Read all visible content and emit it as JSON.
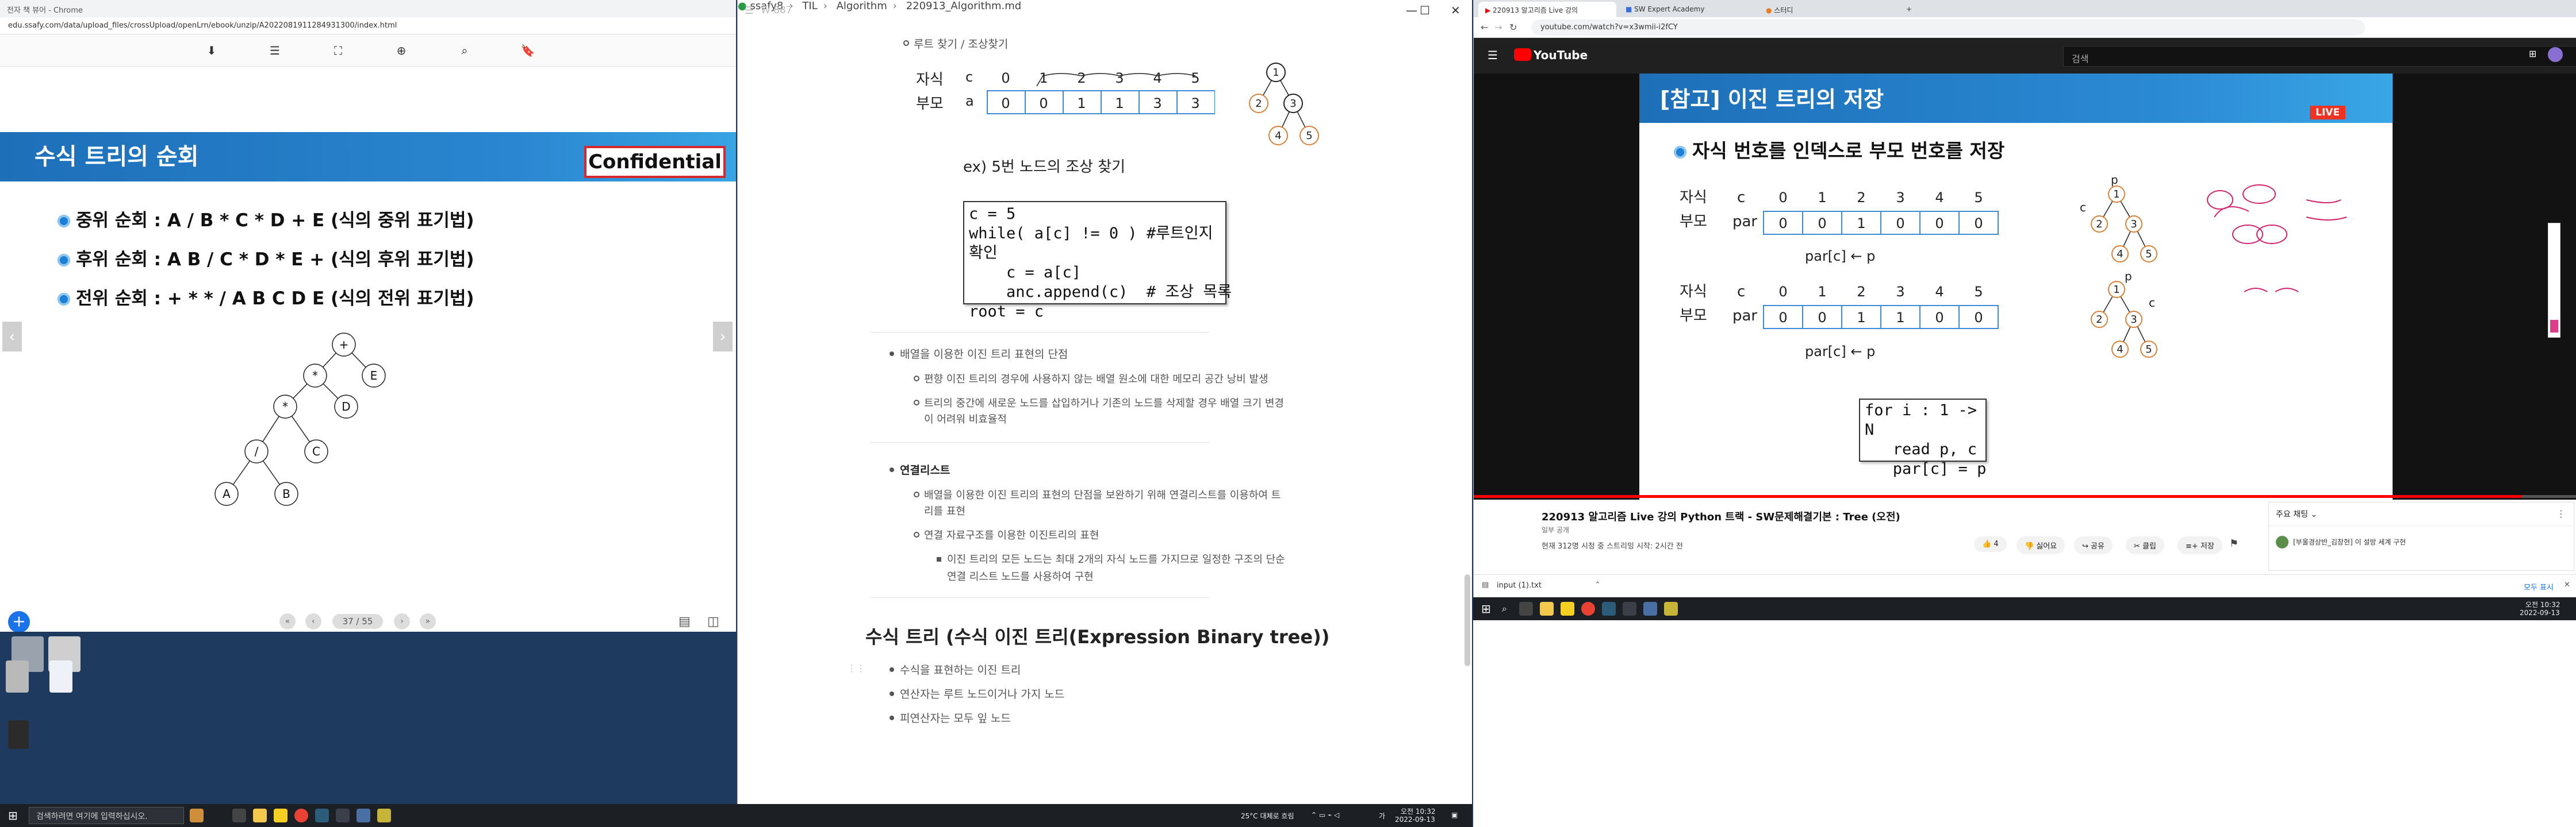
{
  "ebook": {
    "window_title": "전자 책 뷰어 - Chrome",
    "url": "edu.ssafy.com/data/upload_files/crossUpload/openLrn/ebook/unzip/A2022081911284931300/index.html",
    "slide_title": "수식 트리의 순회",
    "confidential": "Confidential",
    "bullets": [
      "중위 순회 : A / B * C * D + E  (식의 중위 표기법)",
      "후위 순회 : A B / C * D * E + (식의 후위 표기법)",
      "전위 순회 : + * * / A B C D E (식의 전위 표기법)"
    ],
    "tree_nodes": [
      "+",
      "*",
      "E",
      "*",
      "D",
      "/",
      "C",
      "A",
      "B"
    ],
    "page_count": "37 / 55"
  },
  "typora": {
    "faded_title": "W 887",
    "breadcrumb": [
      "ssafy8",
      "TIL",
      "Algorithm",
      "220913_Algorithm.md"
    ],
    "root_find": "루트 찾기 / 조상찾기",
    "row_child": "자식",
    "row_parent": "부모",
    "row_c": "c",
    "row_a": "a",
    "indices": [
      "0",
      "1",
      "2",
      "3",
      "4",
      "5"
    ],
    "values": [
      "0",
      "0",
      "1",
      "1",
      "3",
      "3"
    ],
    "tree_nodes": [
      "1",
      "2",
      "3",
      "4",
      "5"
    ],
    "ex_label": "ex) 5번 노드의 조상 찾기",
    "code": [
      "c = 5",
      "while( a[c] != 0 ) #루트인지 확인",
      "    c = a[c]",
      "    anc.append(c)  # 조상 목록",
      "root = c"
    ],
    "array_header": "배열을 이용한 이진 트리 표현의 단점",
    "array_items": [
      "편향 이진 트리의 경우에 사용하지 않는 배열 원소에 대한 메모리 공간 낭비 발생",
      "트리의 중간에 새로운 노드를 삽입하거나 기존의 노드를 삭제할 경우 배열 크기 변경",
      "이 어려워 비효율적"
    ],
    "linked_header": "연결리스트",
    "linked_items": [
      "배열을 이용한 이진 트리의 표현의 단점을 보완하기 위해 연결리스트를 이용하여 트",
      "리를 표현",
      "연결 자료구조를 이용한 이진트리의 표현",
      "이진 트리의 모든 노드는 최대 2개의 자식 노드를 가지므로 일정한 구조의 단순",
      "연결 리스트 노드를 사용하여 구현"
    ],
    "h2": "수식 트리 (수식 이진 트리(Expression Binary tree))",
    "h2_items": [
      "수식을 표현하는 이진 트리",
      "연산자는 루트 노드이거나 가지 노드",
      "피연산자는 모두 잎 노드"
    ]
  },
  "youtube": {
    "tabs": [
      "220913 알고리즘 Live 강의",
      "SW Expert Academy",
      "스터디"
    ],
    "url": "youtube.com/watch?v=x3wmii-i2fCY",
    "logo": "YouTube",
    "search_placeholder": "검색",
    "slide_title": "[참고] 이진 트리의 저장",
    "live": "LIVE",
    "bullet": "자식 번호를 인덱스로 부모 번호를 저장",
    "row_child": "자식",
    "row_parent": "부모",
    "c": "c",
    "par": "par",
    "indices": [
      "0",
      "1",
      "2",
      "3",
      "4",
      "5"
    ],
    "values1": [
      "0",
      "0",
      "1",
      "0",
      "0",
      "0"
    ],
    "values2": [
      "0",
      "0",
      "1",
      "1",
      "0",
      "0"
    ],
    "formula": "par[c] ← p",
    "code": [
      "for i : 1 -> N",
      "   read p, c",
      "   par[c] = p"
    ],
    "tree_nodes": [
      "1",
      "2",
      "3",
      "4",
      "5"
    ],
    "tree_p": "p",
    "tree_c": "c",
    "video_title": "220913 알고리즘 Live 강의 Python 트랙 - SW문제해결기본 : Tree (오전)",
    "channel": "일부 공개",
    "views": "현재 312명 시청 중 스트리밍 시작: 2시간 전",
    "actions": [
      "4",
      "싫어요",
      "공유",
      "클립",
      "저장"
    ],
    "chat_header": "주요 채팅",
    "chat_line": "[부울경상반_김창현] 이 설방 세계 구현",
    "download_file": "input (1).txt",
    "download_all": "모두 표시",
    "progress": 0.95
  },
  "taskbar": {
    "search": "검색하려면 여기에 입력하십시오.",
    "weather": "25°C  대체로 흐림",
    "ime": "가",
    "time": "오전 10:32",
    "date": "2022-09-13"
  }
}
